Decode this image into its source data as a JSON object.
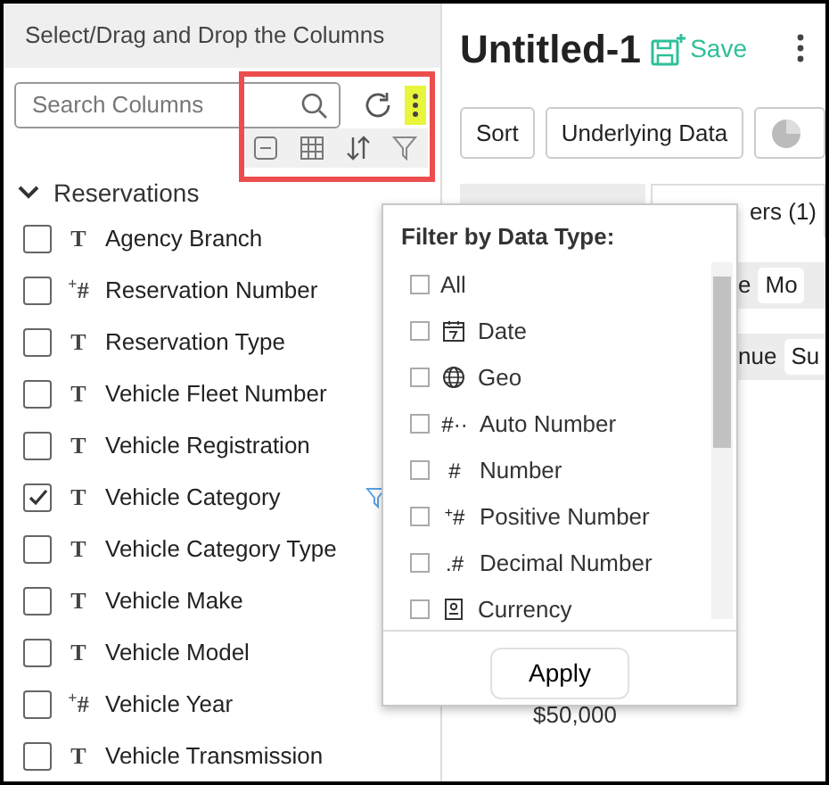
{
  "sidebar": {
    "header": "Select/Drag and Drop the Columns",
    "search": {
      "placeholder": "Search Columns"
    },
    "group": {
      "label": "Reservations",
      "expanded": true,
      "columns": [
        {
          "glyph": "T",
          "label": "Agency Branch",
          "checked": false,
          "filtered": false
        },
        {
          "glyph": "$^{+}$#",
          "label": "Reservation Number",
          "checked": false,
          "filtered": false
        },
        {
          "glyph": "T",
          "label": "Reservation Type",
          "checked": false,
          "filtered": false
        },
        {
          "glyph": "T",
          "label": "Vehicle Fleet Number",
          "checked": false,
          "filtered": false
        },
        {
          "glyph": "T",
          "label": "Vehicle Registration",
          "checked": false,
          "filtered": false
        },
        {
          "glyph": "T",
          "label": "Vehicle Category",
          "checked": true,
          "filtered": true
        },
        {
          "glyph": "T",
          "label": "Vehicle Category Type",
          "checked": false,
          "filtered": false
        },
        {
          "glyph": "T",
          "label": "Vehicle Make",
          "checked": false,
          "filtered": false
        },
        {
          "glyph": "T",
          "label": "Vehicle Model",
          "checked": false,
          "filtered": false
        },
        {
          "glyph": "$^{+}$#",
          "label": "Vehicle Year",
          "checked": false,
          "filtered": false
        },
        {
          "glyph": "T",
          "label": "Vehicle Transmission",
          "checked": false,
          "filtered": false
        }
      ]
    }
  },
  "report": {
    "title": "Untitled-1",
    "save": "Save",
    "toolbar": [
      "Sort",
      "Underlying Data"
    ],
    "tab": "ers (1)",
    "shelves": [
      {
        "label": "e",
        "pill": "Mo"
      },
      {
        "label": "nue",
        "pill": "Su"
      }
    ],
    "axis_label": "$50,000"
  },
  "filter_popup": {
    "title": "Filter by Data Type:",
    "options": [
      {
        "kind": "none",
        "label": "All",
        "checked": false
      },
      {
        "kind": "date",
        "label": "Date",
        "checked": false
      },
      {
        "kind": "geo",
        "label": "Geo",
        "checked": false
      },
      {
        "kind": "glyph",
        "glyph": "#··",
        "label": "Auto Number",
        "checked": false
      },
      {
        "kind": "glyph",
        "glyph": "#",
        "label": "Number",
        "checked": false
      },
      {
        "kind": "glyph",
        "glyph": "$^{+}$#",
        "label": "Positive Number",
        "checked": false
      },
      {
        "kind": "glyph",
        "glyph": ".#",
        "label": "Decimal Number",
        "checked": false
      },
      {
        "kind": "currency",
        "label": "Currency",
        "checked": false
      }
    ],
    "apply": "Apply"
  }
}
